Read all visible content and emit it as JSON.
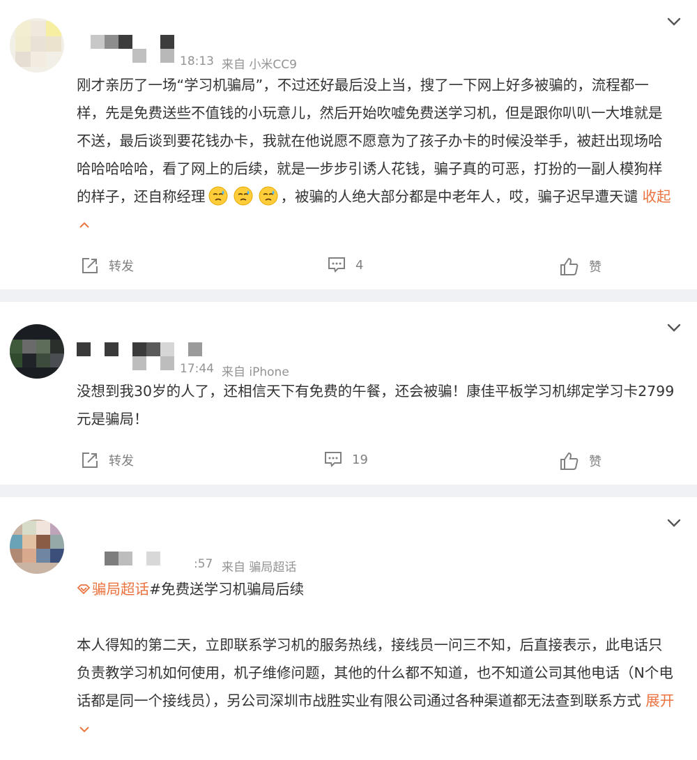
{
  "posts": [
    {
      "meta_time": "18:13",
      "meta_source": "来自 小米CC9",
      "text_before": "刚才亲历了一场“学习机骗局”，不过还好最后没上当，搜了一下网上好多被骗的，流程都一样，先是免费送些不值钱的小玩意儿，然后开始吹嘘免费送学习机，但是跟你叭叭一大堆就是不送，最后谈到要花钱办卡，我就在他说愿不愿意为了孩子办卡的时候没举手，被赶出现场哈哈哈哈哈哈，看了网上的后续，就是一步步引诱人花钱，骗子真的可恶，打扮的一副人模狗样的样子，还自称经理",
      "text_after": "，被骗的人绝大部分都是中老年人，哎，骗子迟早遭天谴",
      "toggle_label": "收起",
      "repost_label": "转发",
      "comment_count": "4",
      "like_label": "赞"
    },
    {
      "meta_time": "17:44",
      "meta_source": "来自 iPhone",
      "text": "没想到我30岁的人了，还相信天下有免费的午餐，还会被骗！康佳平板学习机绑定学习卡2799元是骗局！",
      "repost_label": "转发",
      "comment_count": "19",
      "like_label": "赞"
    },
    {
      "meta_time": ":57",
      "meta_source": "来自 骗局超话",
      "topic_label": "骗局超话",
      "hashtag": "#免费送学习机骗局后续",
      "text": "本人得知的第二天，立即联系学习机的服务热线，接线员一问三不知，后直接表示，此电话只负责教学习机如何使用，机子维修问题，其他的什么都不知道，也不知道公司其他电话（N个电话都是同一个接线员），另公司深圳市战胜实业有限公司通过各种渠道都无法查到联系方式",
      "toggle_label": "展开"
    }
  ],
  "colors": {
    "accent": "#eb7340",
    "text": "#333333",
    "muted": "#939393",
    "divider": "#f0f1f4"
  }
}
